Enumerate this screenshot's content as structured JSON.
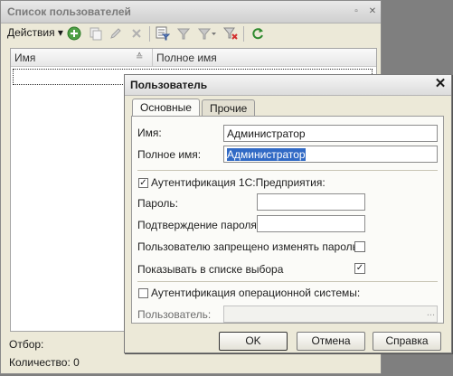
{
  "list_window": {
    "title": "Список пользователей",
    "pin_icon": "pin-icon",
    "close_glyph": "✕",
    "toolbar": {
      "actions_label": "Действия",
      "icons": [
        "add-icon",
        "copy-icon",
        "edit-icon",
        "delete-icon",
        "filter-settings-icon",
        "filter-icon",
        "filter-by-value-icon",
        "clear-filter-icon",
        "refresh-icon"
      ]
    },
    "columns": [
      "Имя",
      "Полное имя"
    ],
    "filter_label": "Отбор:",
    "count_label": "Количество: 0"
  },
  "dialog": {
    "title": "Пользователь",
    "tabs": [
      {
        "label": "Основные",
        "active": true
      },
      {
        "label": "Прочие",
        "active": false
      }
    ],
    "name_label": "Имя:",
    "name_value": "Администратор",
    "fullname_label": "Полное имя:",
    "fullname_value": "Администратор",
    "auth_1c_label": "Аутентификация 1С:Предприятия:",
    "auth_1c_checked": true,
    "password_label": "Пароль:",
    "password_confirm_label": "Подтверждение пароля:",
    "forbid_change_label": "Пользователю запрещено изменять пароль",
    "forbid_change_checked": false,
    "show_in_list_label": "Показывать в списке выбора",
    "show_in_list_checked": true,
    "os_auth_label": "Аутентификация операционной системы:",
    "os_auth_checked": false,
    "os_user_label": "Пользователь:",
    "os_user_browse": "...",
    "ok_label": "OK",
    "cancel_label": "Отмена",
    "help_label": "Справка"
  }
}
